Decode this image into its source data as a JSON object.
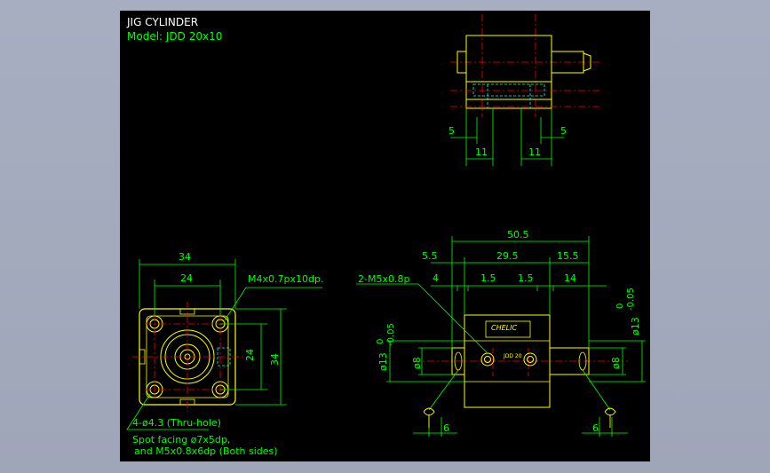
{
  "drawing": {
    "title": "JIG CYLINDER",
    "model": "Model: JDD 20x10",
    "colors": {
      "background": "#000000",
      "frame": "#a7aec1",
      "part": "#ffff00",
      "dimension": "#00ff00",
      "centerline": "#ff0000",
      "hidden": "#00ffff",
      "title": "#ffffff"
    }
  },
  "top_view": {
    "dims": [
      "5",
      "11",
      "11",
      "5"
    ]
  },
  "front_view": {
    "dims": {
      "width_34": "34",
      "width_24": "24",
      "height_24": "24",
      "height_34": "34"
    },
    "thread_note": "M4x0.7px10dp.",
    "hole_note": "4-ø4.3 (Thru-hole)",
    "spot_note_1": "Spot facing ø7x5dp,",
    "spot_note_2": "and M5x0.8x6dp (Both sides)"
  },
  "side_view": {
    "dims": {
      "overall": "50.5",
      "left": "5.5",
      "mid": "29.5",
      "right": "15.5",
      "a": "4",
      "b": "1.5",
      "c": "1.5",
      "d": "14",
      "bottom_left": "6",
      "bottom_right": "6",
      "rod_left": "ø8",
      "rod_right": "ø8"
    },
    "port_note": "2-M5x0.8p",
    "tol_left": "ø13",
    "tol_left_0": "0",
    "tol_left_m": "-0.05",
    "tol_right": "ø13",
    "tol_right_0": "0",
    "tol_right_m": "-0.05",
    "label_brand": "CHELIC",
    "label_model": "JDD 20"
  }
}
